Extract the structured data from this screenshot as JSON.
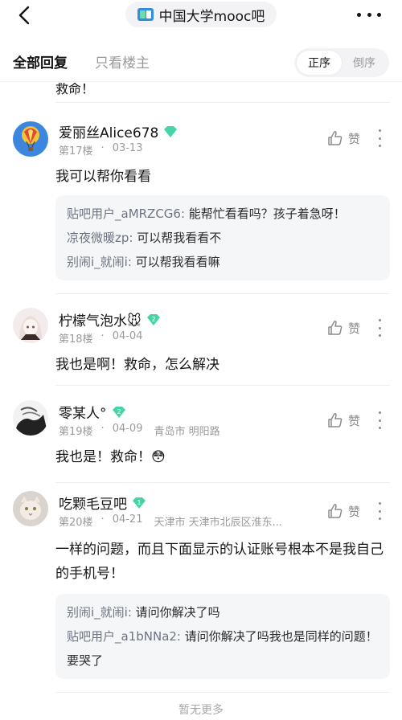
{
  "nav": {
    "forum_name": "中国大学mooc吧",
    "back_icon": "chevron-left-icon",
    "more_icon": "more-dots-icon"
  },
  "tabs": {
    "all": "全部回复",
    "owner_only": "只看楼主"
  },
  "order": {
    "asc": "正序",
    "desc": "倒序",
    "selected": "正序"
  },
  "prev_post_tail": "救命！",
  "like_label": "赞",
  "posts": [
    {
      "username": "爱丽丝Alice678",
      "badge_level": "",
      "floor": "第17楼",
      "date": "03-13",
      "location": "",
      "content": "我可以帮你看看",
      "replies": [
        {
          "user": "贴吧用户_aMRZCG6:",
          "text": " 能帮忙看看吗？孩子着急呀！"
        },
        {
          "user": "凉夜微暖zp:",
          "text": " 可以帮我看看不"
        },
        {
          "user": "别闹i_就闹i:",
          "text": " 可以帮我看看嘛"
        }
      ]
    },
    {
      "username": "柠檬气泡水🐭",
      "badge_level": "2",
      "floor": "第18楼",
      "date": "04-04",
      "location": "",
      "content": "我也是啊！救命，怎么解决",
      "replies": []
    },
    {
      "username": "零某人°",
      "badge_level": "2",
      "floor": "第19楼",
      "date": "04-09",
      "location": "青岛市 明阳路",
      "content": "我也是！救命！😳",
      "replies": []
    },
    {
      "username": "吃颗毛豆吧",
      "badge_level": "1",
      "floor": "第20楼",
      "date": "04-21",
      "location": "天津市 天津市北辰区淮东...",
      "content": "一样的问题，而且下面显示的认证账号根本不是我自己的手机号！",
      "replies": [
        {
          "user": "别闹i_就闹i:",
          "text": " 请问你解决了吗"
        },
        {
          "user": "贴吧用户_a1bNNa2:",
          "text": " 请问你解决了吗我也是同样的问题！要哭了"
        }
      ]
    }
  ],
  "footer": {
    "no_more": "暂无更多"
  },
  "colors": {
    "accent_green": "#46d3a8",
    "text_primary": "#141414",
    "text_secondary": "#9b9b9b",
    "reply_bg": "#f5f6f8"
  }
}
